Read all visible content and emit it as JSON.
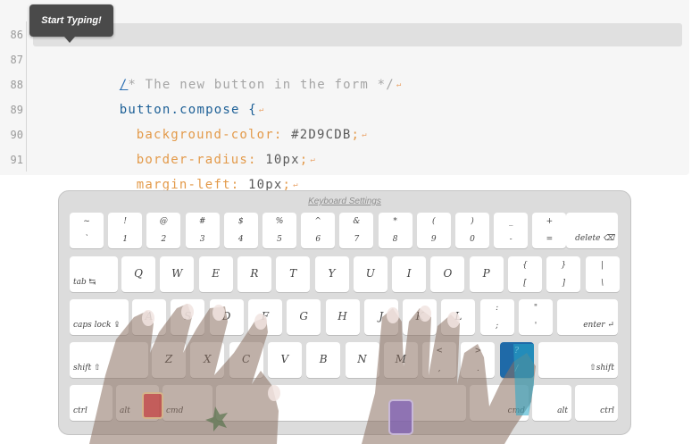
{
  "editor": {
    "lines": [
      {
        "num": "86"
      },
      {
        "num": "87"
      },
      {
        "num": "88"
      },
      {
        "num": "89"
      },
      {
        "num": "90"
      },
      {
        "num": "91"
      }
    ],
    "line87": {
      "cursor": "/",
      "text": "* The new button in the form */"
    },
    "line88": {
      "text": "button.compose {"
    },
    "line89": {
      "prop": "background-color",
      "colon": ":",
      "value": " #2D9CDB",
      "semi": ";"
    },
    "line90": {
      "prop": "border-radius",
      "colon": ":",
      "value": " 10px",
      "semi": ";"
    },
    "line91": {
      "prop": "margin-left",
      "colon": ":",
      "value": " 10px",
      "semi": ";"
    },
    "return_glyph": "↵"
  },
  "tooltip": {
    "text": "Start Typing!"
  },
  "keyboard": {
    "title": "Keyboard Settings",
    "row1": [
      {
        "top": "~",
        "bot": "`"
      },
      {
        "top": "!",
        "bot": "1"
      },
      {
        "top": "@",
        "bot": "2"
      },
      {
        "top": "#",
        "bot": "3"
      },
      {
        "top": "$",
        "bot": "4"
      },
      {
        "top": "%",
        "bot": "5"
      },
      {
        "top": "^",
        "bot": "6"
      },
      {
        "top": "&",
        "bot": "7"
      },
      {
        "top": "*",
        "bot": "8"
      },
      {
        "top": "(",
        "bot": "9"
      },
      {
        "top": ")",
        "bot": "0"
      },
      {
        "top": "_",
        "bot": "-"
      },
      {
        "top": "+",
        "bot": "="
      }
    ],
    "delete": "delete ⌫",
    "tab": "tab ↹",
    "row2": [
      "Q",
      "W",
      "E",
      "R",
      "T",
      "Y",
      "U",
      "I",
      "O",
      "P"
    ],
    "row2_sym": [
      {
        "top": "{",
        "bot": "["
      },
      {
        "top": "}",
        "bot": "]"
      },
      {
        "top": "|",
        "bot": "\\"
      }
    ],
    "caps": "caps lock ⇪",
    "row3": [
      "A",
      "S",
      "D",
      "F",
      "G",
      "H",
      "J",
      "K",
      "L"
    ],
    "row3_sym": [
      {
        "top": ":",
        "bot": ";"
      },
      {
        "top": "\"",
        "bot": "'"
      }
    ],
    "enter": "enter ↵",
    "shift_l": "shift ⇧",
    "row4": [
      "Z",
      "X",
      "C",
      "V",
      "B",
      "N",
      "M"
    ],
    "row4_sym": [
      {
        "top": "<",
        "bot": ","
      },
      {
        "top": ">",
        "bot": "."
      },
      {
        "top": "?",
        "bot": "/"
      }
    ],
    "shift_r": "⇧shift",
    "ctrl_l": "ctrl",
    "alt_l": "alt",
    "cmd_l": "cmd",
    "cmd_r": "cmd",
    "alt_r": "alt",
    "ctrl_r": "ctrl",
    "active_key": "?",
    "active_color": "#1F6AA8"
  }
}
